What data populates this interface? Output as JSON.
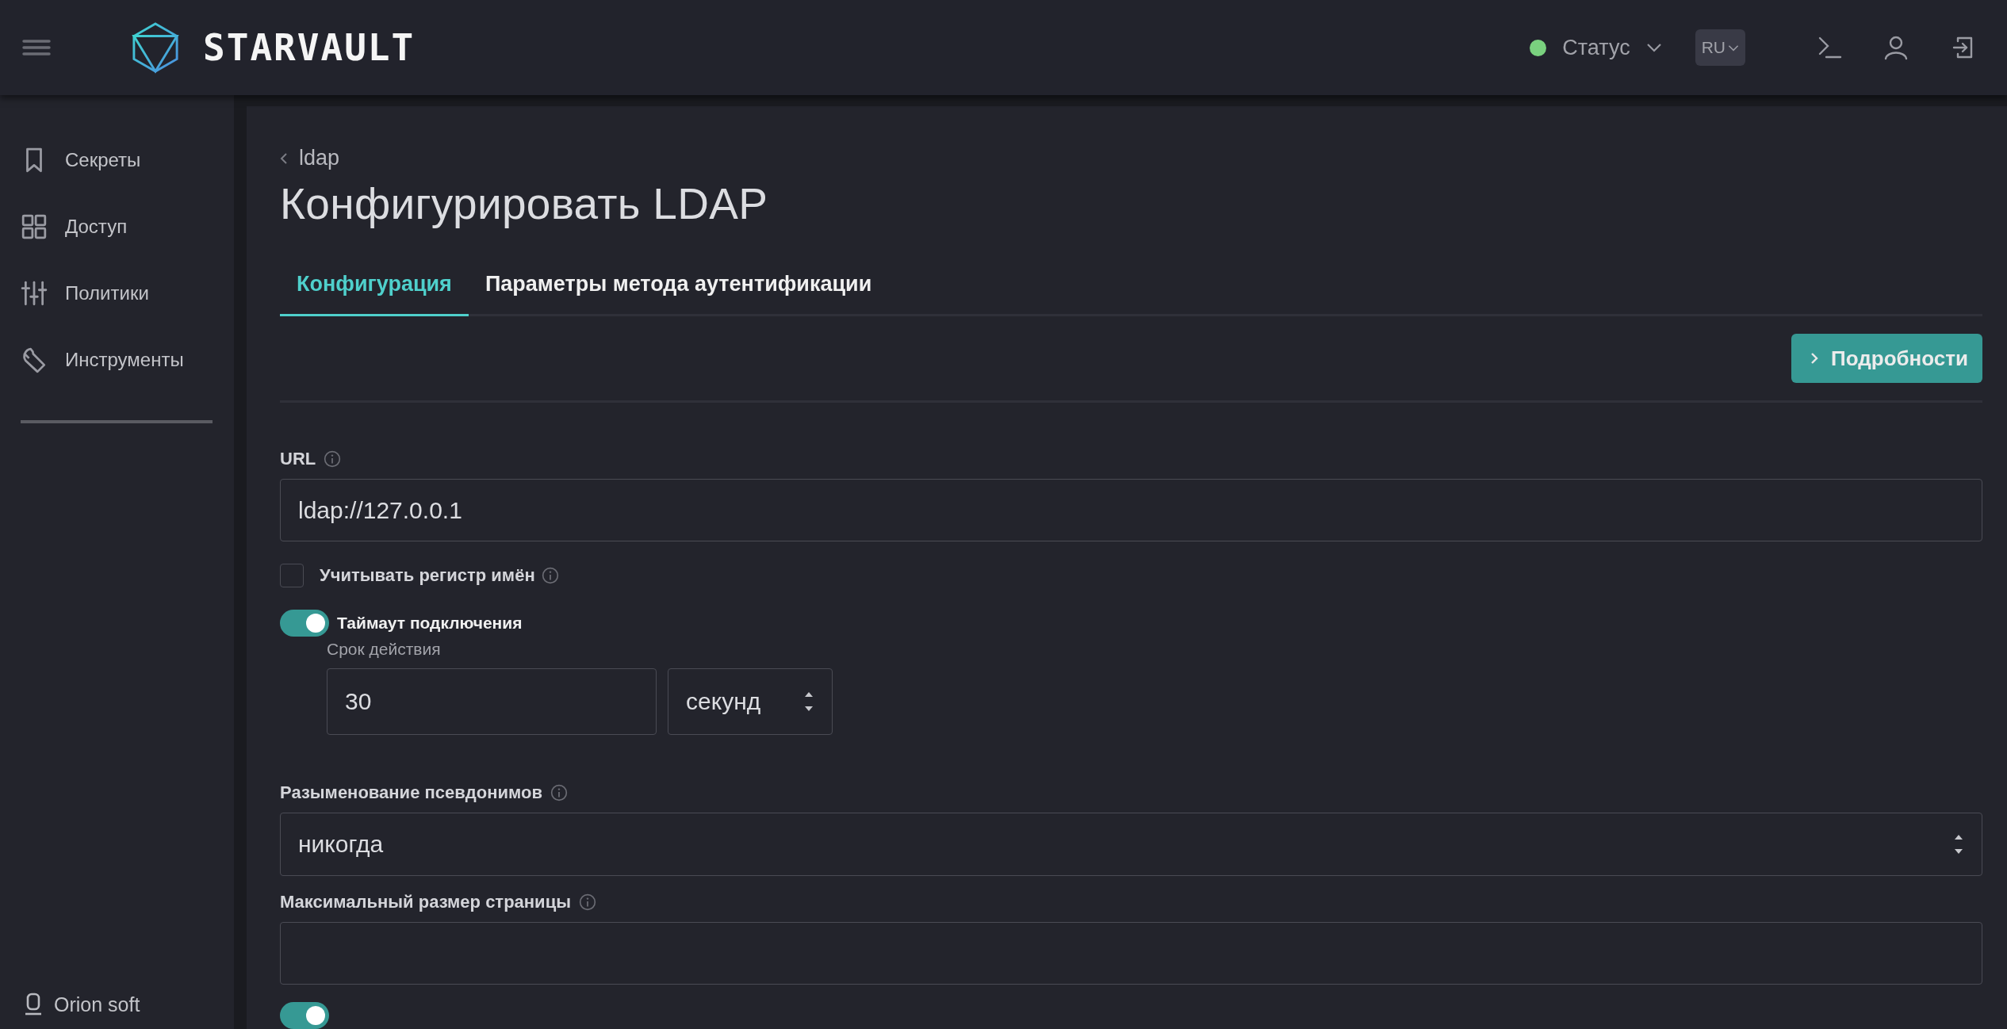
{
  "header": {
    "logo": "STARVAULT",
    "status": {
      "label": "Статус",
      "color": "#7ad17f"
    },
    "language": "RU"
  },
  "sidebar": {
    "items": [
      {
        "label": "Секреты",
        "kind": "bookmark"
      },
      {
        "label": "Доступ",
        "kind": "grid"
      },
      {
        "label": "Политики",
        "kind": "sliders"
      },
      {
        "label": "Инструменты",
        "kind": "tools"
      }
    ],
    "footer": "Orion soft"
  },
  "breadcrumb": "ldap",
  "title": "Конфигурировать LDAP",
  "tabs": [
    {
      "label": "Конфигурация",
      "selected": true
    },
    {
      "label": "Параметры метода аутентификации",
      "selected": false
    }
  ],
  "details_button": "Подробности",
  "form": {
    "url": {
      "label": "URL",
      "value": "ldap://127.0.0.1"
    },
    "case_sensitive": {
      "label": "Учитывать регистр имён",
      "checked": false
    },
    "timeout": {
      "label": "Таймаут подключения",
      "on": true,
      "sublabel": "Срок действия",
      "value": "30",
      "unit": "секунд"
    },
    "deref_aliases": {
      "label": "Разыменование псевдонимов",
      "value": "никогда"
    },
    "max_page_size": {
      "label": "Максимальный размер страницы"
    },
    "next_toggle": {
      "on": true
    }
  }
}
